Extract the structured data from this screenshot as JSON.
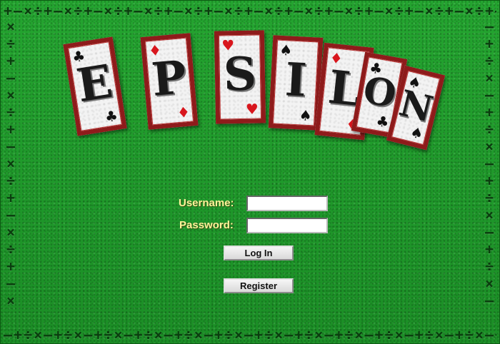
{
  "logo": {
    "letters": [
      {
        "char": "E",
        "suit_top": "♣",
        "suit_bottom": "♣",
        "suit_color": "black"
      },
      {
        "char": "P",
        "suit_top": "♦",
        "suit_bottom": "♦",
        "suit_color": "red"
      },
      {
        "char": "S",
        "suit_top": "♥",
        "suit_bottom": "♥",
        "suit_color": "red"
      },
      {
        "char": "I",
        "suit_top": "♠",
        "suit_bottom": "♠",
        "suit_color": "black"
      },
      {
        "char": "L",
        "suit_top": "♦",
        "suit_bottom": "♦",
        "suit_color": "red"
      },
      {
        "char": "O",
        "suit_top": "♣",
        "suit_bottom": "♣",
        "suit_color": "black"
      },
      {
        "char": "N",
        "suit_top": "♠",
        "suit_bottom": "♠",
        "suit_color": "black"
      }
    ],
    "card_border_color": "#8e1b1b"
  },
  "login": {
    "username_label": "Username:",
    "username_value": "",
    "password_label": "Password:",
    "password_value": "",
    "login_button": "Log In",
    "register_button": "Register"
  },
  "colors": {
    "felt": "#1f9a2a",
    "label": "#fff59a",
    "border_glyphs": "#0a3d0e"
  }
}
